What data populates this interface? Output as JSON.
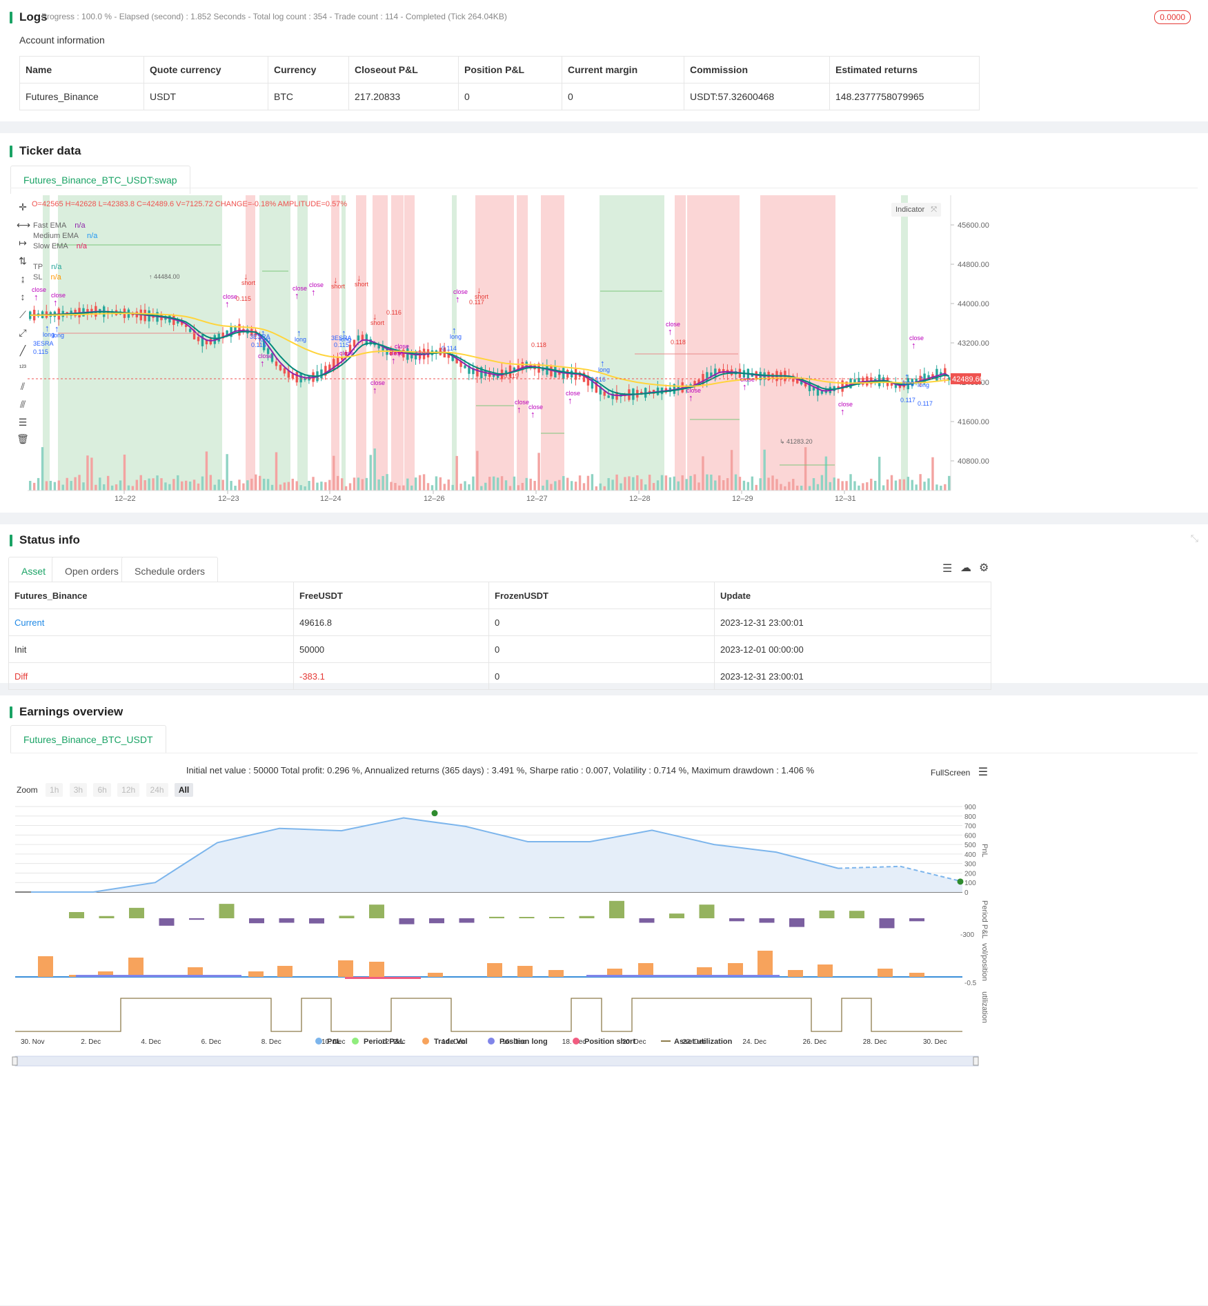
{
  "logs": {
    "title": "Logs",
    "status": "Progress : 100.0 % - Elapsed (second) : 1.852  Seconds - Total log count : 354 - Trade count : 114 - Completed (Tick 264.04KB)",
    "badge": "0.0000"
  },
  "account": {
    "title": "Account information",
    "headers": [
      "Name",
      "Quote currency",
      "Currency",
      "Closeout P&L",
      "Position P&L",
      "Current margin",
      "Commission",
      "Estimated returns"
    ],
    "row": [
      "Futures_Binance",
      "USDT",
      "BTC",
      "217.20833",
      "0",
      "0",
      "USDT:57.32600468",
      "148.2377758079965"
    ]
  },
  "ticker": {
    "title": "Ticker data",
    "tab": "Futures_Binance_BTC_USDT:swap",
    "ohlc": "O=42565 H=42628 L=42383.8 C=42489.6 V=7125.72 CHANGE=-0.18% AMPLITUDE=0.57%",
    "indicator_btn": "Indicator",
    "legend": [
      {
        "name": "Fast EMA",
        "value": "n/a",
        "color": "#8e24aa"
      },
      {
        "name": "Medium EMA",
        "value": "n/a",
        "color": "#2196f3"
      },
      {
        "name": "Slow EMA",
        "value": "n/a",
        "color": "#e91e63"
      },
      {
        "name": "TP",
        "value": "n/a",
        "color": "#26a69a"
      },
      {
        "name": "SL",
        "value": "n/a",
        "color": "#ff9800"
      }
    ],
    "price_ticks": [
      "45600.00",
      "44800.00",
      "44000.00",
      "43200.00",
      "42400.00",
      "41600.00",
      "40800.00"
    ],
    "current_price": "42489.60",
    "date_ticks": [
      "12–22",
      "12–23",
      "12–24",
      "12–26",
      "12–27",
      "12–28",
      "12–29",
      "12–31"
    ],
    "high_label": "44484.00",
    "low_label": "41283.20",
    "marks": [
      "close",
      "long",
      "short",
      "3ESRA",
      "0.115",
      "0.116",
      "0.117",
      "0.118",
      "0.119",
      "0.114"
    ],
    "colors": {
      "up": "#26a69a",
      "down": "#ef5350",
      "fast": "#8e24aa",
      "slow": "#ffd43b",
      "mid": "#00897b"
    }
  },
  "status": {
    "title": "Status info",
    "tabs": [
      "Asset",
      "Open orders",
      "Schedule orders"
    ],
    "headers": [
      "Futures_Binance",
      "FreeUSDT",
      "FrozenUSDT",
      "Update"
    ],
    "rows": [
      [
        "Current",
        "49616.8",
        "0",
        "2023-12-31 23:00:01"
      ],
      [
        "Init",
        "50000",
        "0",
        "2023-12-01 00:00:00"
      ],
      [
        "Diff",
        "-383.1",
        "0",
        "2023-12-31 23:00:01"
      ]
    ]
  },
  "earnings": {
    "title": "Earnings overview",
    "tab": "Futures_Binance_BTC_USDT",
    "summary": "Initial net value : 50000 Total profit: 0.296 %, Annualized returns (365 days) : 3.491 %, Sharpe ratio : 0.007, Volatility : 0.714 %, Maximum drawdown : 1.406 %",
    "fullscreen": "FullScreen",
    "zoom_label": "Zoom",
    "zoom_buttons": [
      "1h",
      "3h",
      "6h",
      "12h",
      "24h",
      "All"
    ],
    "pnl_ticks": [
      "900",
      "800",
      "700",
      "600",
      "500",
      "400",
      "300",
      "200",
      "100",
      "0"
    ],
    "pnl_axis": "PnL",
    "period_axis": "Period P&L",
    "period_tick": "-300",
    "vol_axis": "vol/position",
    "vol_tick": "-0.5",
    "util_axis": "utilization",
    "x_ticks": [
      "30. Nov",
      "2. Dec",
      "4. Dec",
      "6. Dec",
      "8. Dec",
      "10. Dec",
      "12. Dec",
      "14. Dec",
      "16. Dec",
      "18. Dec",
      "20. Dec",
      "22. Dec",
      "24. Dec",
      "26. Dec",
      "28. Dec",
      "30. Dec"
    ],
    "legend": [
      {
        "name": "PnL",
        "color": "#7cb5ec"
      },
      {
        "name": "Period P&L",
        "color": "#90ed7d"
      },
      {
        "name": "Trade Vol",
        "color": "#f7a35c"
      },
      {
        "name": "Position long",
        "color": "#8085e9"
      },
      {
        "name": "Position short",
        "color": "#f15c80"
      },
      {
        "name": "Asset utilization",
        "color": "#8d7b4a"
      }
    ],
    "chart_data": {
      "type": "line",
      "x": [
        "30. Nov",
        "2. Dec",
        "4. Dec",
        "6. Dec",
        "8. Dec",
        "10. Dec",
        "12. Dec",
        "14. Dec",
        "16. Dec",
        "18. Dec",
        "20. Dec",
        "22. Dec",
        "24. Dec",
        "26. Dec",
        "28. Dec",
        "30. Dec"
      ],
      "series": [
        {
          "name": "PnL",
          "values": [
            0,
            0,
            100,
            520,
            670,
            645,
            780,
            690,
            530,
            530,
            650,
            500,
            420,
            250,
            270,
            110
          ]
        },
        {
          "name": "Period P&L",
          "values": [
            0,
            30,
            140,
            -60,
            -20,
            110,
            -40,
            -60,
            -70,
            20,
            100,
            -80,
            -40,
            -60,
            20,
            -40
          ]
        }
      ],
      "ylim": [
        0,
        900
      ]
    }
  }
}
